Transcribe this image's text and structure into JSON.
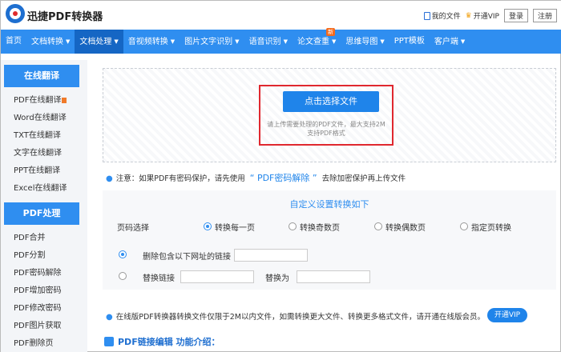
{
  "app": {
    "title": "迅捷PDF转换器"
  },
  "top_links": {
    "my_files": "我的文件",
    "vip": "开通VIP",
    "login": "登录",
    "register": "注册"
  },
  "nav": {
    "items": [
      {
        "label": "首页",
        "caret": false
      },
      {
        "label": "文档转换",
        "caret": true
      },
      {
        "label": "文档处理",
        "caret": true,
        "active": true
      },
      {
        "label": "音视频转换",
        "caret": true
      },
      {
        "label": "图片文字识别",
        "caret": true
      },
      {
        "label": "语音识别",
        "caret": true
      },
      {
        "label": "论文查重",
        "caret": true,
        "badge": "新"
      },
      {
        "label": "思维导图",
        "caret": true
      },
      {
        "label": "PPT模板",
        "caret": false
      },
      {
        "label": "客户端",
        "caret": true
      }
    ]
  },
  "sidebar": {
    "sections": [
      {
        "title": "在线翻译",
        "items": [
          "PDF在线翻译",
          "Word在线翻译",
          "TXT在线翻译",
          "文字在线翻译",
          "PPT在线翻译",
          "Excel在线翻译"
        ]
      },
      {
        "title": "PDF处理",
        "items": [
          "PDF合并",
          "PDF分割",
          "PDF密码解除",
          "PDF增加密码",
          "PDF修改密码",
          "PDF图片获取",
          "PDF删除页"
        ]
      }
    ]
  },
  "upload": {
    "button": "点击选择文件",
    "hint_line1": "请上传需要处理的PDF文件，最大支持2M",
    "hint_line2": "支持PDF格式"
  },
  "notice1": {
    "prefix": "注意：如果PDF有密码保护，请先使用",
    "link": "“ PDF密码解除 ”",
    "suffix": "去除加密保护再上传文件"
  },
  "settings": {
    "title": "自定义设置转换如下",
    "page_label": "页码选择",
    "page_options": [
      "转换每一页",
      "转换奇数页",
      "转换偶数页",
      "指定页转换"
    ],
    "remove_link_label": "删除包含以下网址的链接",
    "replace_link_label": "替换链接",
    "replace_with_label": "替换为"
  },
  "notice2": {
    "text": "在线版PDF转换器转换文件仅限于2M以内文件，如需转换更大文件、转换更多格式文件，请开通在线版会员。",
    "vip_button": "开通VIP"
  },
  "section": {
    "title": "PDF链接编辑 功能介绍："
  },
  "colors": {
    "accent": "#2f8ef0",
    "nav_active": "#1566c4",
    "highlight": "#e0282f"
  }
}
